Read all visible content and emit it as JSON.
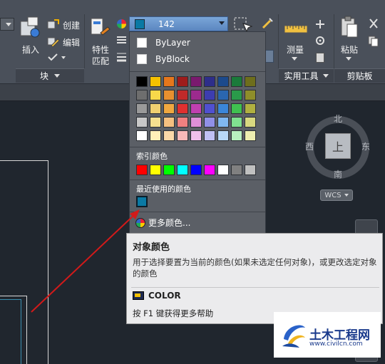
{
  "ribbon": {
    "insert_label": "插入",
    "create_label": "创建",
    "edit_label": "编辑",
    "match_props_label": "特性\n匹配",
    "measure_label": "测量",
    "paste_label": "粘贴",
    "block_panel": "块",
    "utilities_panel": "实用工具",
    "clipboard_panel": "剪贴板"
  },
  "color_combo": {
    "value": "142",
    "swatch_color": "#0a79a4"
  },
  "color_dropdown": {
    "bylayer": "ByLayer",
    "byblock": "ByBlock",
    "index_colors_title": "索引颜色",
    "recent_colors_title": "最近使用的颜色",
    "more_colors": "更多颜色...",
    "grid_colors": [
      "#000000",
      "#f5c000",
      "#e6771c",
      "#9e1c1c",
      "#7a1a6e",
      "#2e2e8a",
      "#1c4a8c",
      "#1a7a3a",
      "#6e6e1c",
      "#6e6e6e",
      "#f7d84a",
      "#e8902f",
      "#c02a2a",
      "#9c2a8e",
      "#3d3db0",
      "#2a66b0",
      "#2a9a4a",
      "#8e8e2a",
      "#9a9a9a",
      "#f0d070",
      "#f0a840",
      "#e03030",
      "#c040b0",
      "#5050d0",
      "#3b86d8",
      "#40c050",
      "#b0b040",
      "#c8c8c8",
      "#f5e090",
      "#f5c080",
      "#f08080",
      "#e090d8",
      "#9090e8",
      "#80b8f0",
      "#80e090",
      "#d8d880",
      "#ffffff",
      "#fff0b8",
      "#fad8a8",
      "#f8b8b8",
      "#f0c0ec",
      "#c0c0f4",
      "#b8d8f8",
      "#b8f0c0",
      "#eeeeb0"
    ],
    "index_colors": [
      "#ff0000",
      "#ffff00",
      "#00ff00",
      "#00ffff",
      "#0000ff",
      "#ff00ff",
      "#ffffff",
      "#808080",
      "#c0c0c0"
    ],
    "recent_color": "#0a79a4"
  },
  "tooltip": {
    "title": "对象颜色",
    "description": "用于选择要置为当前的颜色(如果未选定任何对象)，或更改选定对象的颜色",
    "command": "COLOR",
    "help": "按 F1 键获得更多帮助"
  },
  "viewcube": {
    "north": "北",
    "south": "南",
    "east": "东",
    "west": "西",
    "top": "上",
    "wcs": "WCS"
  },
  "watermark": {
    "name": "土木工程网",
    "url": "www.civilcn.com"
  },
  "colors": {
    "arrow": "#d21a1a",
    "ribbon_bg": "#4a505a",
    "canvas_bg": "#20262e"
  }
}
